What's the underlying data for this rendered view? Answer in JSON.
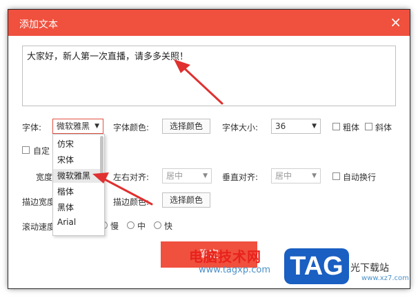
{
  "dialog": {
    "title": "添加文本",
    "close_glyph": "×",
    "text_content": "大家好，新人第一次直播，请多多关照！",
    "confirm_label": "确定"
  },
  "font_row": {
    "font_label": "字体:",
    "font_value": "微软雅黑",
    "color_label": "字体颜色:",
    "color_button": "选择颜色",
    "size_label": "字体大小:",
    "size_value": "36",
    "bold_label": "粗体",
    "italic_label": "斜体"
  },
  "custom_row": {
    "custom_label": "自定"
  },
  "align_row": {
    "width_label": "宽度",
    "h_align_label": "左右对齐:",
    "h_align_value": "居中",
    "v_align_label": "垂直对齐:",
    "v_align_value": "居中",
    "wrap_label": "自动换行"
  },
  "stroke_row": {
    "stroke_width_label": "描边宽度",
    "stroke_color_label": "描边颜色:",
    "stroke_color_button": "选择颜色"
  },
  "scroll_row": {
    "scroll_label": "滚动速度",
    "slow": "慢",
    "medium": "中",
    "fast": "快"
  },
  "font_dropdown": {
    "items": [
      "仿宋",
      "宋体",
      "微软雅黑",
      "楷体",
      "黑体",
      "Arial"
    ],
    "selected_index": 2
  },
  "watermark": {
    "site_name": "电脑技术网",
    "url": "www.tagxp.com",
    "logo": "TAG",
    "side_text": "光下载站",
    "side_url": "www.xz7.com"
  },
  "colors": {
    "accent": "#f0503e",
    "arrow": "#e03030"
  }
}
